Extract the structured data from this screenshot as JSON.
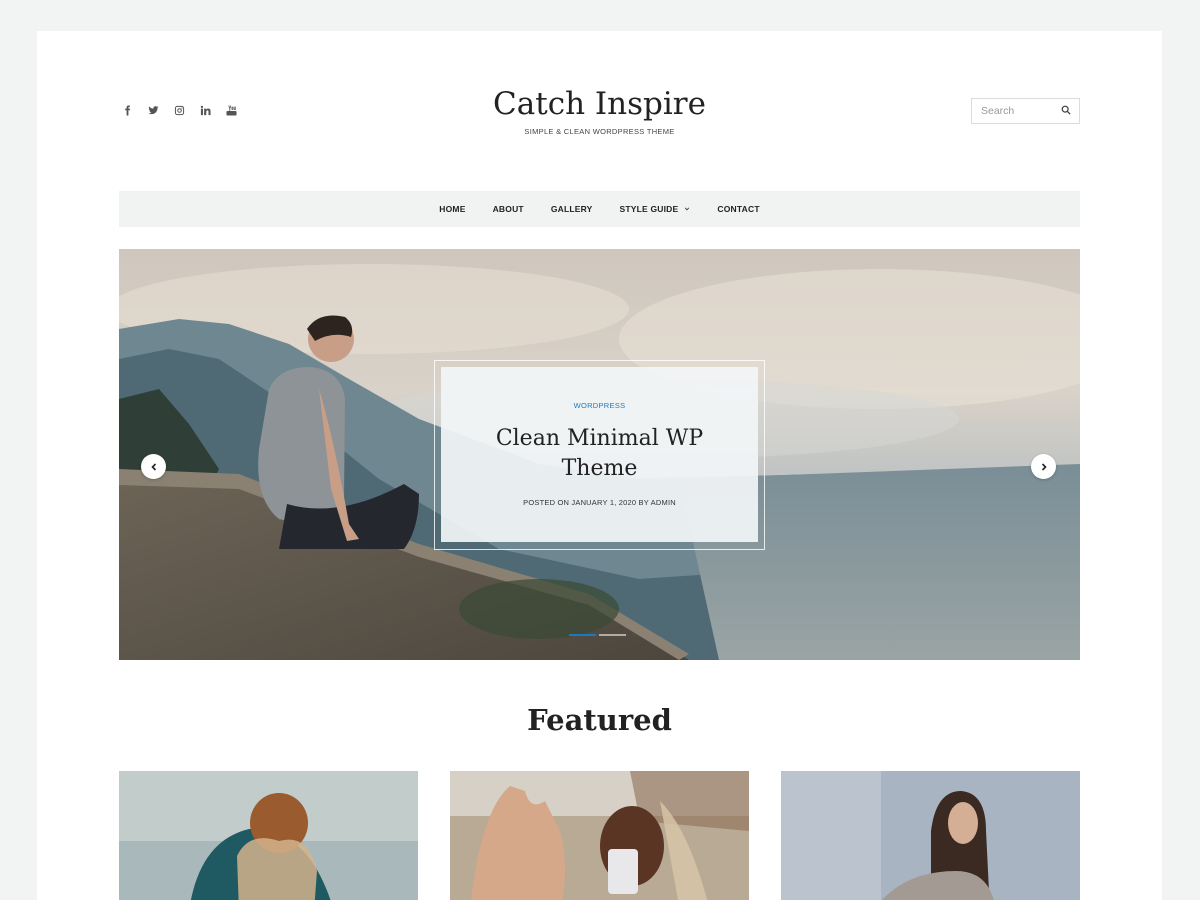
{
  "site": {
    "title": "Catch Inspire",
    "tagline": "SIMPLE & CLEAN WORDPRESS THEME"
  },
  "social": [
    "facebook-icon",
    "twitter-icon",
    "instagram-icon",
    "linkedin-icon",
    "youtube-icon"
  ],
  "search": {
    "placeholder": "Search"
  },
  "nav": {
    "items": [
      {
        "label": "HOME"
      },
      {
        "label": "ABOUT"
      },
      {
        "label": "GALLERY"
      },
      {
        "label": "STYLE GUIDE",
        "has_submenu": true
      },
      {
        "label": "CONTACT"
      }
    ]
  },
  "slider": {
    "category": "WORDPRESS",
    "title_line1": "Clean Minimal WP",
    "title_line2": "Theme",
    "meta": "POSTED ON JANUARY 1, 2020 BY ADMIN",
    "slide_count": 2,
    "active_slide": 1
  },
  "featured": {
    "heading": "Featured",
    "cards": [
      "featured-image-1",
      "featured-image-2",
      "featured-image-3"
    ]
  },
  "colors": {
    "accent": "#1c79c0",
    "background": "#f2f4f3",
    "nav_bg": "#f1f3f2"
  }
}
